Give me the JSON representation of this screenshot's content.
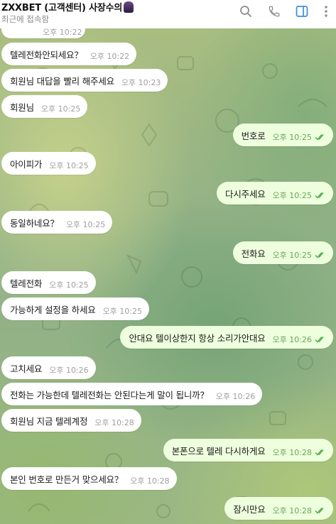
{
  "header": {
    "title": "ZXXBET (고객센터) 사장수의",
    "status": "최근에 접속함"
  },
  "messages": [
    {
      "text": "...",
      "time": "오후 10:22",
      "dir": "in",
      "partial": true
    },
    {
      "text": "텔레전화안되세요？",
      "time": "오후 10:22",
      "dir": "in"
    },
    {
      "text": "회원님 대답을 빨리 해주세요",
      "time": "오후 10:23",
      "dir": "in"
    },
    {
      "text": "회원님",
      "time": "오후 10:25",
      "dir": "in"
    },
    {
      "text": "번호로",
      "time": "오후 10:25",
      "dir": "out"
    },
    {
      "text": "아이피가",
      "time": "오후 10:25",
      "dir": "in"
    },
    {
      "text": "다시주세요",
      "time": "오후 10:25",
      "dir": "out"
    },
    {
      "text": "동일하네요？",
      "time": "오후 10:25",
      "dir": "in"
    },
    {
      "text": "전화요",
      "time": "오후 10:25",
      "dir": "out"
    },
    {
      "text": "텔레전화",
      "time": "오후 10:25",
      "dir": "in"
    },
    {
      "text": "가능하게 설정을 하세요",
      "time": "오후 10:25",
      "dir": "in"
    },
    {
      "text": "안대요 텔이상한지 항상 소리가안대요",
      "time": "오후 10:26",
      "dir": "out"
    },
    {
      "text": "고치세요",
      "time": "오후 10:26",
      "dir": "in"
    },
    {
      "text": "전화는 가능한데 텔레전화는 안된다는게 말이 됩니까？",
      "time": "오후 10:26",
      "dir": "in"
    },
    {
      "text": "회원님 지금 텔레계정",
      "time": "오후 10:28",
      "dir": "in"
    },
    {
      "text": "본폰으로 텔레 다시하게요",
      "time": "오후 10:28",
      "dir": "out"
    },
    {
      "text": "본인 번호로 만든거 맞으세요？",
      "time": "오후 10:28",
      "dir": "in"
    },
    {
      "text": "잠시만요",
      "time": "오후 10:28",
      "dir": "out"
    }
  ],
  "icons": [
    "search-icon",
    "phone-icon",
    "sidebar-toggle-icon",
    "more-vertical-icon",
    "double-check-icon"
  ],
  "colors": {
    "incoming_bubble": "#ffffff",
    "outgoing_bubble": "#eeffde",
    "read_check": "#4fae4e",
    "accent": "#3a8fd6"
  }
}
